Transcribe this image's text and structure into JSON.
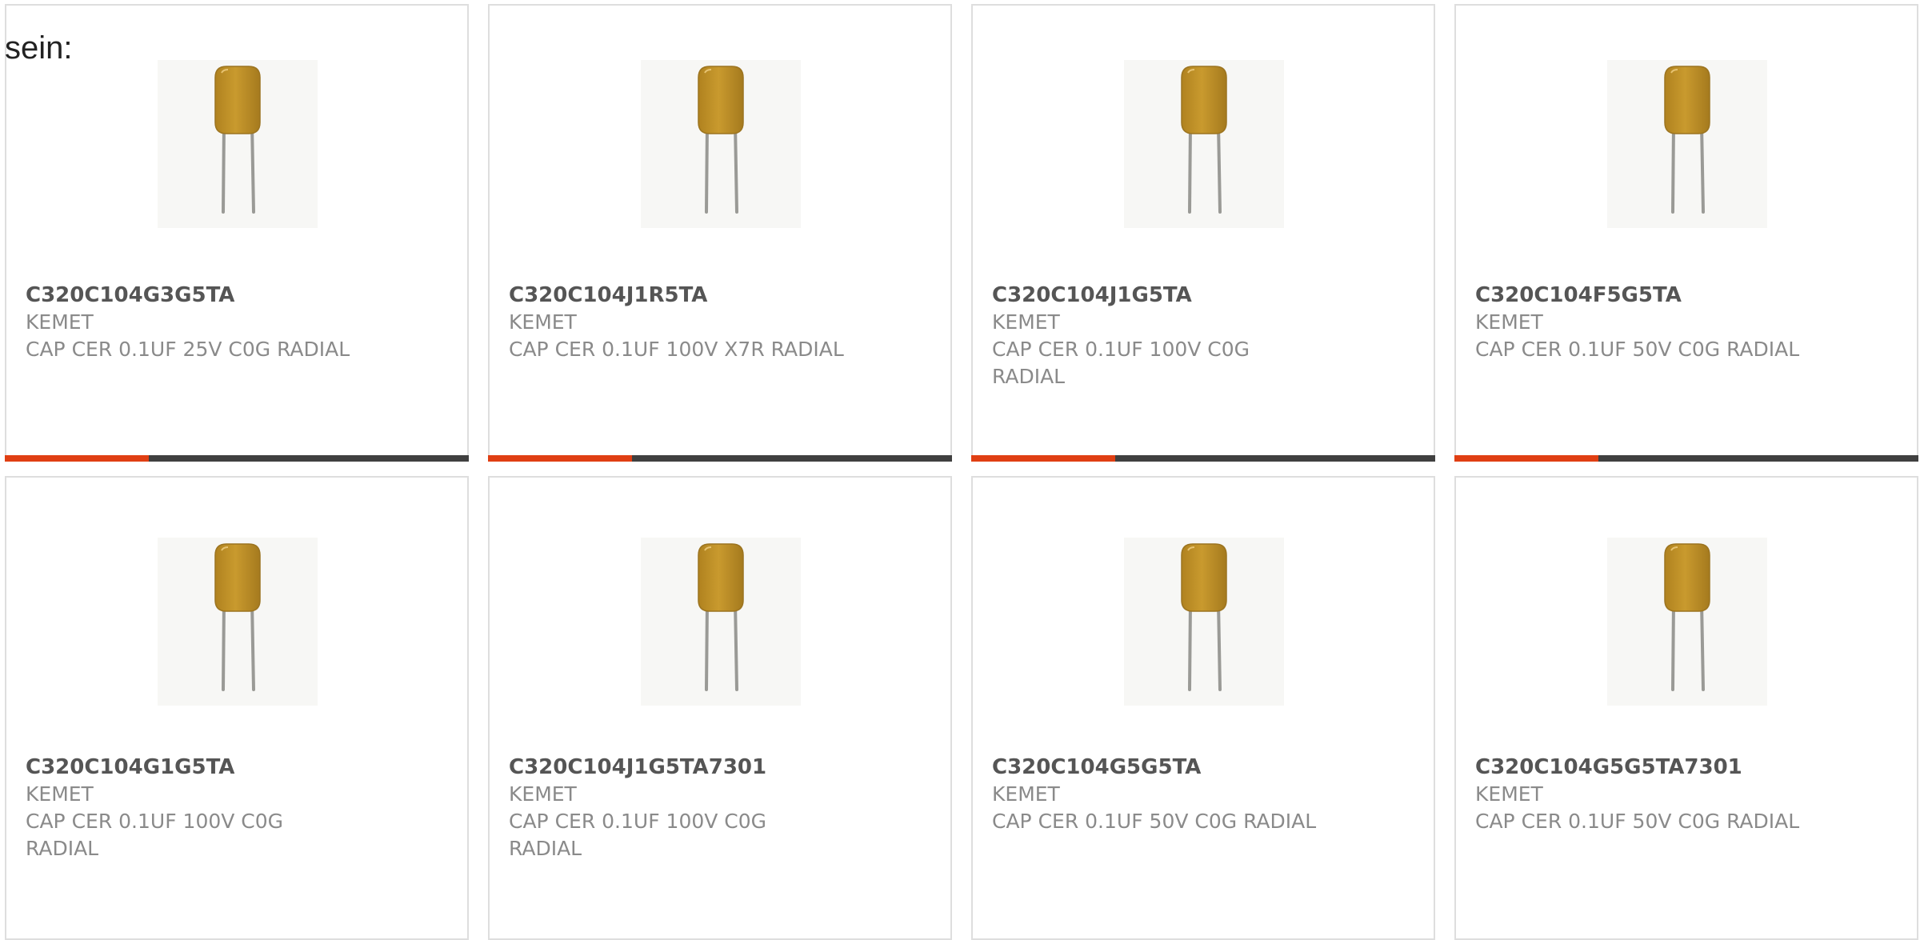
{
  "intro_text": "sein:",
  "colors": {
    "accent": "#e03f13",
    "bar_track": "#404040",
    "part_text": "#555555",
    "meta_text": "#8a8a8a",
    "card_border": "#dedede",
    "capacitor_body": "#c99a2e"
  },
  "icons": {
    "product_image": "radial-ceramic-capacitor-image"
  },
  "products": [
    {
      "part": "C320C104G3G5TA",
      "maker": "KEMET",
      "desc": "CAP CER 0.1UF 25V C0G RADIAL",
      "progress": 0.31
    },
    {
      "part": "C320C104J1R5TA",
      "maker": "KEMET",
      "desc": "CAP CER 0.1UF 100V X7R RADIAL",
      "progress": 0.31
    },
    {
      "part": "C320C104J1G5TA",
      "maker": "KEMET",
      "desc": "CAP CER 0.1UF 100V C0G RADIAL",
      "progress": 0.31
    },
    {
      "part": "C320C104F5G5TA",
      "maker": "KEMET",
      "desc": "CAP CER 0.1UF 50V C0G RADIAL",
      "progress": 0.31
    },
    {
      "part": "C320C104G1G5TA",
      "maker": "KEMET",
      "desc": "CAP CER 0.1UF 100V C0G RADIAL",
      "progress": 0.31
    },
    {
      "part": "C320C104J1G5TA7301",
      "maker": "KEMET",
      "desc": "CAP CER 0.1UF 100V C0G RADIAL",
      "progress": 0.31
    },
    {
      "part": "C320C104G5G5TA",
      "maker": "KEMET",
      "desc": "CAP CER 0.1UF 50V C0G RADIAL",
      "progress": 0.31
    },
    {
      "part": "C320C104G5G5TA7301",
      "maker": "KEMET",
      "desc": "CAP CER 0.1UF 50V C0G RADIAL",
      "progress": 0.31
    }
  ]
}
